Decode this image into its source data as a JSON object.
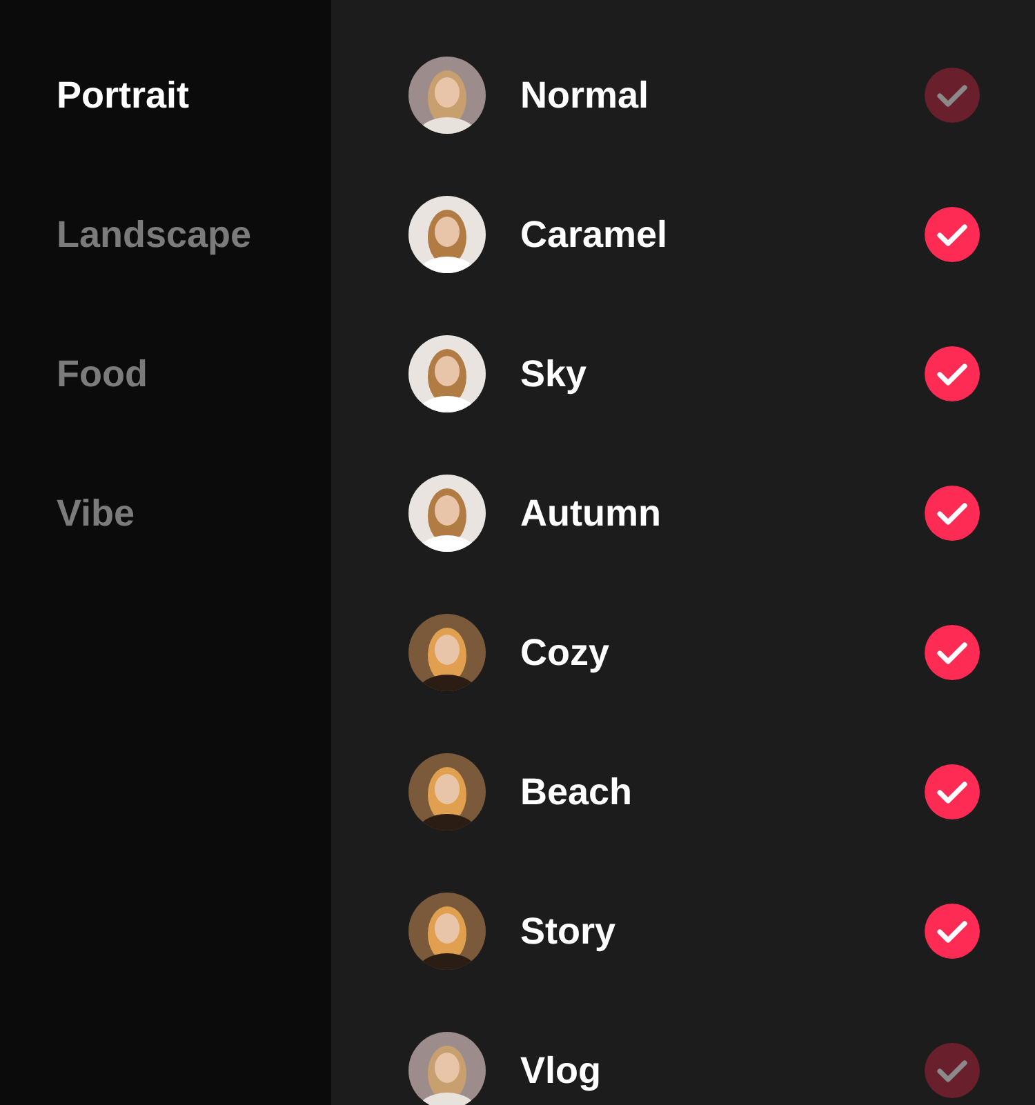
{
  "sidebar": {
    "items": [
      {
        "label": "Portrait",
        "selected": true
      },
      {
        "label": "Landscape",
        "selected": false
      },
      {
        "label": "Food",
        "selected": false
      },
      {
        "label": "Vibe",
        "selected": false
      }
    ]
  },
  "filters": [
    {
      "name": "Normal",
      "checked": false
    },
    {
      "name": "Caramel",
      "checked": true
    },
    {
      "name": "Sky",
      "checked": true
    },
    {
      "name": "Autumn",
      "checked": true
    },
    {
      "name": "Cozy",
      "checked": true
    },
    {
      "name": "Beach",
      "checked": true
    },
    {
      "name": "Story",
      "checked": true
    },
    {
      "name": "Vlog",
      "checked": false
    }
  ]
}
